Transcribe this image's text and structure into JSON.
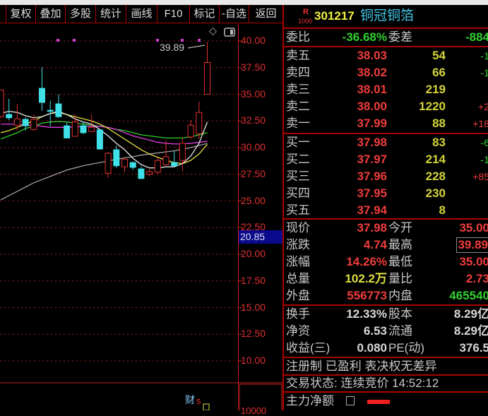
{
  "toolbar": {
    "items": [
      "复权",
      "叠加",
      "多股",
      "统计",
      "画线",
      "F10",
      "标记",
      "-自选",
      "返回"
    ]
  },
  "chart": {
    "high_label": "39.89",
    "current_price_box": "20.85",
    "finance_marker": "财",
    "axis_labels": [
      "40.00",
      "37.50",
      "35.00",
      "32.50",
      "30.00",
      "27.50",
      "25.00",
      "22.50",
      "20.00",
      "17.50",
      "15.00",
      "12.50",
      "10.00"
    ],
    "volume_axis_label": "10000",
    "colors": {
      "up": "#e03030",
      "down": "#40e0e8",
      "ma5": "#e8e8e8",
      "ma10": "#e0e040",
      "ma20": "#e040e0",
      "ma30": "#30d030",
      "ma60": "#a0a0a0"
    },
    "candles": [
      [
        32.9,
        35.4,
        35.4,
        32.8
      ],
      [
        33.11,
        32.8,
        34.57,
        32.58
      ],
      [
        32.1,
        32.7,
        34.1,
        31.6
      ],
      [
        32.65,
        32.05,
        32.85,
        31.6
      ],
      [
        31.7,
        32.65,
        33.1,
        31.6
      ],
      [
        35.56,
        34.24,
        37.55,
        33.45
      ],
      [
        33.5,
        33.4,
        34.4,
        32.0
      ],
      [
        34.1,
        32.9,
        35.0,
        32.8
      ],
      [
        32.05,
        30.9,
        32.4,
        30.9
      ],
      [
        31.06,
        32.4,
        33.1,
        31.06
      ],
      [
        32.05,
        31.4,
        32.4,
        31.26
      ],
      [
        31.5,
        31.9,
        33.1,
        31.5
      ],
      [
        31.66,
        29.87,
        31.66,
        29.8
      ],
      [
        27.6,
        29.47,
        29.6,
        27.2
      ],
      [
        29.8,
        28.3,
        30.2,
        28.1
      ],
      [
        28.2,
        28.9,
        29.1,
        27.7
      ],
      [
        28.6,
        28.15,
        28.7,
        27.9
      ],
      [
        28.0,
        27.1,
        28.2,
        27.1
      ],
      [
        27.5,
        27.75,
        28.0,
        27.3
      ],
      [
        27.7,
        28.8,
        29.1,
        27.5
      ],
      [
        28.4,
        29.15,
        30.7,
        28.3
      ],
      [
        28.6,
        28.3,
        29.7,
        28.2
      ],
      [
        28.8,
        30.4,
        30.95,
        27.8
      ],
      [
        31.0,
        32.1,
        32.6,
        30.8
      ],
      [
        31.3,
        33.3,
        34.3,
        30.8
      ],
      [
        35.0,
        37.98,
        39.89,
        35.0
      ]
    ],
    "ma": {
      "ma5": [
        33.2,
        33.4,
        33.3,
        33.0,
        32.8,
        32.9,
        33.2,
        33.4,
        33.1,
        32.7,
        32.4,
        32.2,
        31.7,
        31.1,
        30.4,
        29.8,
        29.0,
        28.4,
        28.1,
        28.1,
        28.2,
        28.2,
        28.5,
        29.2,
        30.4,
        32.4
      ],
      "ma10": [
        31.4,
        31.6,
        31.9,
        32.2,
        32.5,
        32.9,
        33.2,
        33.3,
        33.1,
        32.9,
        32.7,
        32.5,
        32.2,
        31.8,
        31.3,
        30.8,
        30.3,
        29.8,
        29.4,
        29.1,
        28.8,
        28.6,
        28.5,
        28.8,
        29.4,
        30.3
      ],
      "ma20": [
        32.2,
        32.2,
        32.2,
        32.1,
        32.1,
        32.0,
        31.9,
        31.9,
        31.9,
        31.95,
        32.0,
        32.0,
        32.0,
        31.9,
        31.7,
        31.4,
        31.1,
        30.9,
        30.7,
        30.5,
        30.4,
        30.35,
        30.35,
        30.4,
        30.5,
        30.6
      ],
      "ma30": [
        30.8,
        31.1,
        31.4,
        31.8,
        32.0,
        32.3,
        32.4,
        32.45,
        32.4,
        32.3,
        32.2,
        32.1,
        32.0,
        31.9,
        31.7,
        31.6,
        31.4,
        31.2,
        31.1,
        31.0,
        30.9,
        30.9,
        30.9,
        31.0,
        31.2,
        31.4
      ],
      "ma60": [
        25.1,
        25.5,
        25.9,
        26.3,
        26.7,
        27.0,
        27.3,
        27.6,
        27.9,
        28.1,
        28.3,
        28.45,
        28.6,
        28.75,
        28.9,
        29.05,
        29.15,
        29.3,
        29.4,
        29.5,
        29.6,
        29.7,
        29.85,
        30.0,
        30.2,
        30.4
      ]
    }
  },
  "quote": {
    "badge_top": "R",
    "badge_bottom": "1000",
    "code": "301217",
    "name": "铜冠铜箔",
    "weibi_label": "委比",
    "weibi": "-36.68%",
    "weicha_label": "委差",
    "weicha": "-884",
    "asks": [
      {
        "label": "卖五",
        "price": "38.03",
        "vol": "54",
        "chg": "-1"
      },
      {
        "label": "卖四",
        "price": "38.02",
        "vol": "66",
        "chg": "-1"
      },
      {
        "label": "卖三",
        "price": "38.01",
        "vol": "219",
        "chg": ""
      },
      {
        "label": "卖二",
        "price": "38.00",
        "vol": "1220",
        "chg": "+2"
      },
      {
        "label": "卖一",
        "price": "37.99",
        "vol": "88",
        "chg": "+18"
      }
    ],
    "bids": [
      {
        "label": "买一",
        "price": "37.98",
        "vol": "83",
        "chg": "-6"
      },
      {
        "label": "买二",
        "price": "37.97",
        "vol": "214",
        "chg": "-1"
      },
      {
        "label": "买三",
        "price": "37.96",
        "vol": "228",
        "chg": "+85"
      },
      {
        "label": "买四",
        "price": "37.95",
        "vol": "230",
        "chg": ""
      },
      {
        "label": "买五",
        "price": "37.94",
        "vol": "8",
        "chg": ""
      }
    ],
    "stats": [
      {
        "l1": "现价",
        "v1": "37.98",
        "l2": "今开",
        "v2": "35.00"
      },
      {
        "l1": "涨跌",
        "v1": "4.74",
        "l2": "最高",
        "v2": "39.89"
      },
      {
        "l1": "涨幅",
        "v1": "14.26%",
        "l2": "最低",
        "v2": "35.00"
      },
      {
        "l1": "总量",
        "v1": "102.2万",
        "l2": "量比",
        "v2": "2.73"
      },
      {
        "l1": "外盘",
        "v1": "556773",
        "l2": "内盘",
        "v2": "465540"
      }
    ],
    "fund": [
      {
        "l1": "换手",
        "v1": "12.33%",
        "l2": "股本",
        "v2": "8.29亿"
      },
      {
        "l1": "净资",
        "v1": "6.53",
        "l2": "流通",
        "v2": "8.29亿"
      },
      {
        "l1": "收益(三)",
        "v1": "0.080",
        "l2": "PE(动)",
        "v2": "376.5"
      }
    ],
    "tags": "注册制 已盈利 表决权无差异",
    "status": "交易状态: 连续竞价 14:52:12",
    "main_net_label": "主力净额"
  }
}
